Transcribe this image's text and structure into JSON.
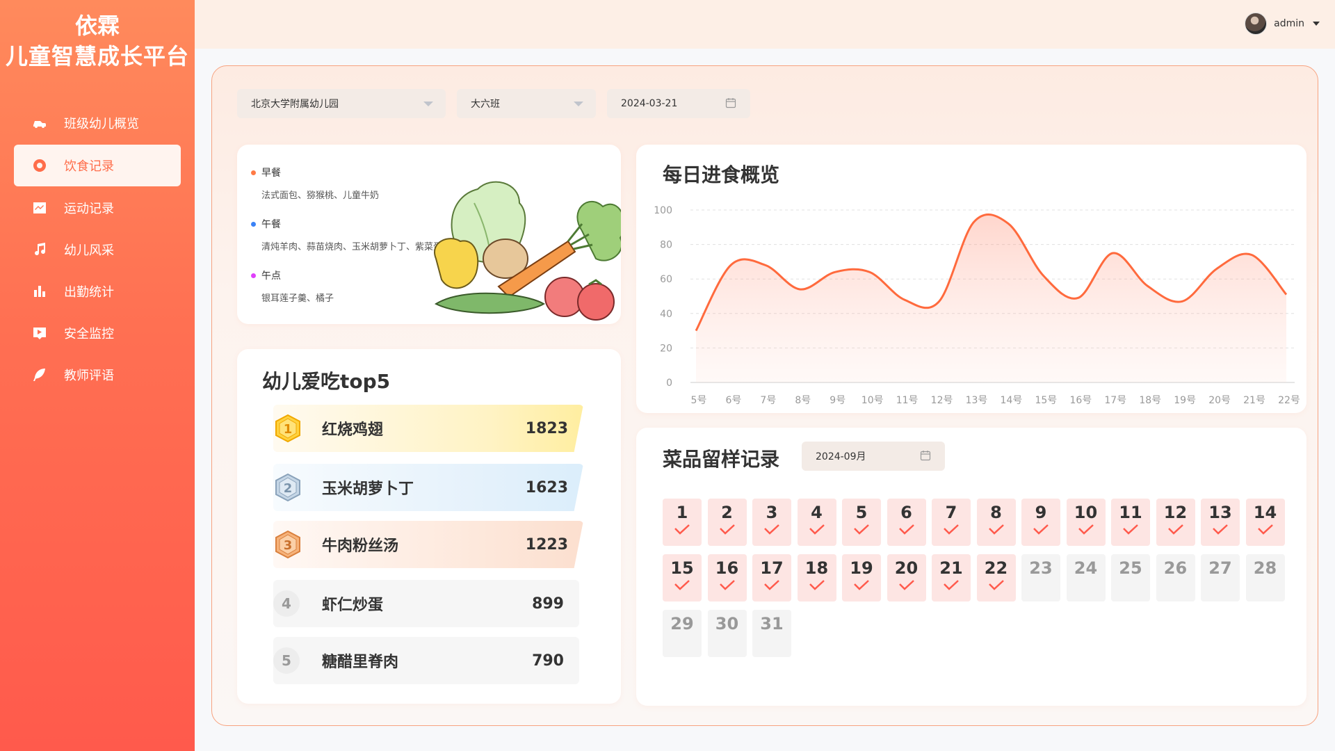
{
  "app": {
    "brand_line1": "依霖",
    "brand_line2": "儿童智慧成长平台",
    "accent": "#ff6d4a"
  },
  "sidebar": {
    "items": [
      {
        "label": "班级幼儿概览",
        "icon": "car-icon",
        "active": false
      },
      {
        "label": "饮食记录",
        "icon": "record-dot-icon",
        "active": true
      },
      {
        "label": "运动记录",
        "icon": "trend-chart-icon",
        "active": false
      },
      {
        "label": "幼儿风采",
        "icon": "music-note-icon",
        "active": false
      },
      {
        "label": "出勤统计",
        "icon": "bar-chart-icon",
        "active": false
      },
      {
        "label": "安全监控",
        "icon": "video-play-icon",
        "active": false
      },
      {
        "label": "教师评语",
        "icon": "feather-icon",
        "active": false
      }
    ]
  },
  "header": {
    "username": "admin"
  },
  "filters": {
    "school": "北京大学附属幼儿园",
    "class": "大六班",
    "date": "2024-03-21"
  },
  "meals": [
    {
      "title": "早餐",
      "desc": "法式面包、猕猴桃、儿童牛奶",
      "color": "#ff7a45"
    },
    {
      "title": "午餐",
      "desc": "清炖羊肉、蒜苗烧肉、玉米胡萝卜丁、紫菜蛋汤",
      "color": "#3b82f6"
    },
    {
      "title": "午点",
      "desc": "银耳莲子羹、橘子",
      "color": "#e040fb"
    }
  ],
  "top5": {
    "title": "幼儿爱吃top5",
    "items": [
      {
        "rank": "1",
        "name": "红烧鸡翅",
        "count": "1823"
      },
      {
        "rank": "2",
        "name": "玉米胡萝卜丁",
        "count": "1623"
      },
      {
        "rank": "3",
        "name": "牛肉粉丝汤",
        "count": "1223"
      },
      {
        "rank": "4",
        "name": "虾仁炒蛋",
        "count": "899"
      },
      {
        "rank": "5",
        "name": "糖醋里脊肉",
        "count": "790"
      }
    ]
  },
  "chart_data": {
    "type": "area",
    "title": "每日进食概览",
    "categories": [
      "5号",
      "6号",
      "7号",
      "8号",
      "9号",
      "10号",
      "11号",
      "12号",
      "13号",
      "14号",
      "15号",
      "16号",
      "17号",
      "18号",
      "19号",
      "20号",
      "21号",
      "22号"
    ],
    "values": [
      30,
      68,
      68,
      54,
      64,
      64,
      48,
      47,
      93,
      92,
      62,
      49,
      75,
      56,
      47,
      66,
      74,
      51
    ],
    "ylim": [
      0,
      100
    ],
    "yticks": [
      0,
      20,
      40,
      60,
      80,
      100
    ],
    "line_color": "#ff6a3d",
    "grid": true
  },
  "samples": {
    "title": "菜品留样记录",
    "month": "2024-09月",
    "days": [
      {
        "d": "1",
        "done": true
      },
      {
        "d": "2",
        "done": true
      },
      {
        "d": "3",
        "done": true
      },
      {
        "d": "4",
        "done": true
      },
      {
        "d": "5",
        "done": true
      },
      {
        "d": "6",
        "done": true
      },
      {
        "d": "7",
        "done": true
      },
      {
        "d": "8",
        "done": true
      },
      {
        "d": "9",
        "done": true
      },
      {
        "d": "10",
        "done": true
      },
      {
        "d": "11",
        "done": true
      },
      {
        "d": "12",
        "done": true
      },
      {
        "d": "13",
        "done": true
      },
      {
        "d": "14",
        "done": true
      },
      {
        "d": "15",
        "done": true
      },
      {
        "d": "16",
        "done": true
      },
      {
        "d": "17",
        "done": true
      },
      {
        "d": "18",
        "done": true
      },
      {
        "d": "19",
        "done": true
      },
      {
        "d": "20",
        "done": true
      },
      {
        "d": "21",
        "done": true
      },
      {
        "d": "22",
        "done": true
      },
      {
        "d": "23",
        "done": false
      },
      {
        "d": "24",
        "done": false
      },
      {
        "d": "25",
        "done": false
      },
      {
        "d": "26",
        "done": false
      },
      {
        "d": "27",
        "done": false
      },
      {
        "d": "28",
        "done": false
      },
      {
        "d": "29",
        "done": false
      },
      {
        "d": "30",
        "done": false
      },
      {
        "d": "31",
        "done": false
      }
    ]
  }
}
